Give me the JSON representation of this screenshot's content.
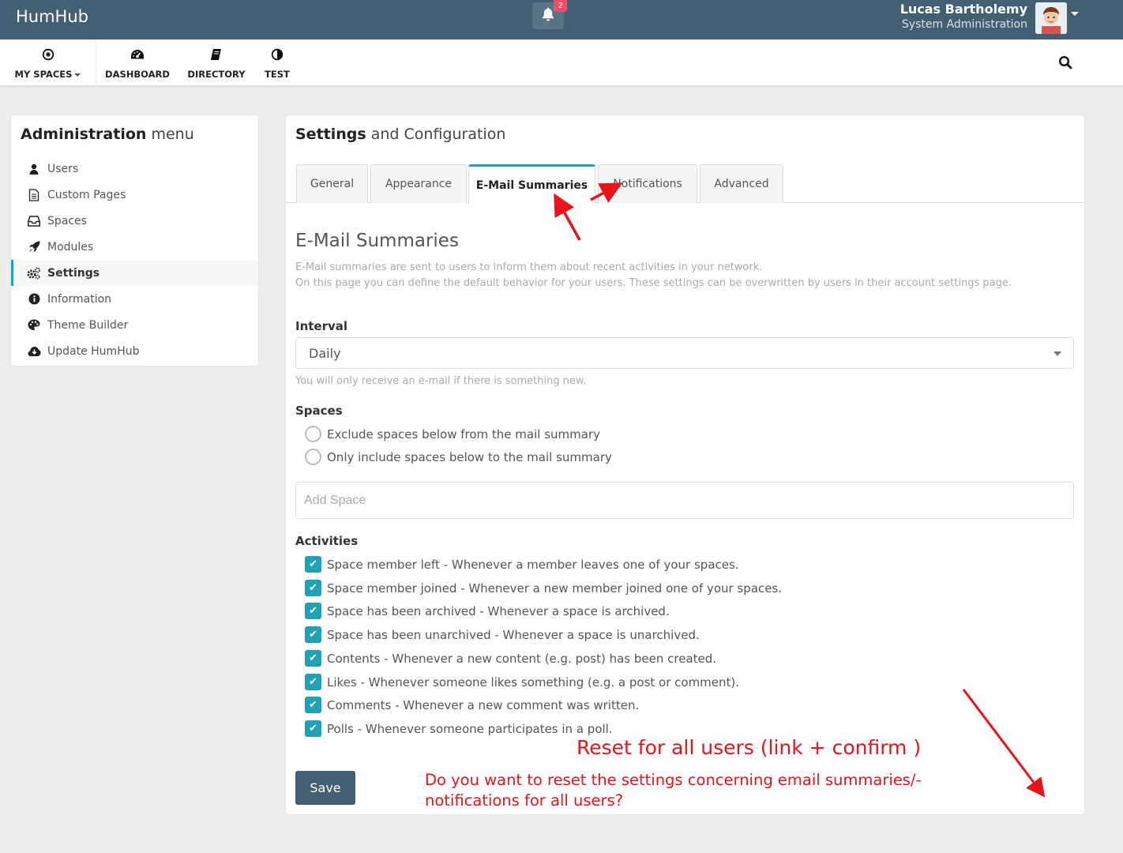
{
  "topbar": {
    "brand": "HumHub",
    "notification_count": "2",
    "user_name": "Lucas Bartholemy",
    "user_role": "System Administration"
  },
  "nav": {
    "items": [
      {
        "label": "MY SPACES",
        "icon": "dot-circle-icon"
      },
      {
        "label": "DASHBOARD",
        "icon": "tachometer-icon"
      },
      {
        "label": "DIRECTORY",
        "icon": "book-icon"
      },
      {
        "label": "TEST",
        "icon": "adjust-icon"
      }
    ]
  },
  "admin_menu": {
    "title_bold": "Administration",
    "title_rest": "menu",
    "items": [
      {
        "label": "Users",
        "icon": "user-icon"
      },
      {
        "label": "Custom Pages",
        "icon": "file-text-icon"
      },
      {
        "label": "Spaces",
        "icon": "inbox-icon"
      },
      {
        "label": "Modules",
        "icon": "rocket-icon"
      },
      {
        "label": "Settings",
        "icon": "cogs-icon",
        "active": true
      },
      {
        "label": "Information",
        "icon": "info-circle-icon"
      },
      {
        "label": "Theme Builder",
        "icon": "palette-icon"
      },
      {
        "label": "Update HumHub",
        "icon": "cloud-download-icon"
      }
    ]
  },
  "main": {
    "title_bold": "Settings",
    "title_rest": "and Configuration",
    "tabs": [
      {
        "label": "General"
      },
      {
        "label": "Appearance"
      },
      {
        "label": "E-Mail Summaries",
        "active": true
      },
      {
        "label": "Notifications"
      },
      {
        "label": "Advanced"
      }
    ],
    "section_title": "E-Mail Summaries",
    "help_line1": "E-Mail summaries are sent to users to inform them about recent activities in your network.",
    "help_line2": "On this page you can define the default behavior for your users. These settings can be overwritten by users in their account settings page.",
    "interval_label": "Interval",
    "interval_value": "Daily",
    "interval_help": "You will only receive an e-mail if there is something new.",
    "spaces_label": "Spaces",
    "spaces_options": [
      "Exclude spaces below from the mail summary",
      "Only include spaces below to the mail summary"
    ],
    "add_space_placeholder": "Add Space",
    "activities_label": "Activities",
    "activities": [
      "Space member left - Whenever a member leaves one of your spaces.",
      "Space member joined - Whenever a new member joined one of your spaces.",
      "Space has been archived - Whenever a space is archived.",
      "Space has been unarchived - Whenever a space is unarchived.",
      "Contents - Whenever a new content (e.g. post) has been created.",
      "Likes - Whenever someone likes something (e.g. a post or comment).",
      "Comments - Whenever a new comment was written.",
      "Polls - Whenever someone participates in a poll."
    ],
    "save_label": "Save"
  },
  "annotations": {
    "note1": "Reset for all users (link + confirm )",
    "note2": "Do you want to reset the settings concerning email summaries/-notifications for all users?",
    "color": "#e8141a"
  },
  "colors": {
    "topbar": "#435f73",
    "accent": "#21a1b3",
    "badge": "#fc4a64"
  }
}
